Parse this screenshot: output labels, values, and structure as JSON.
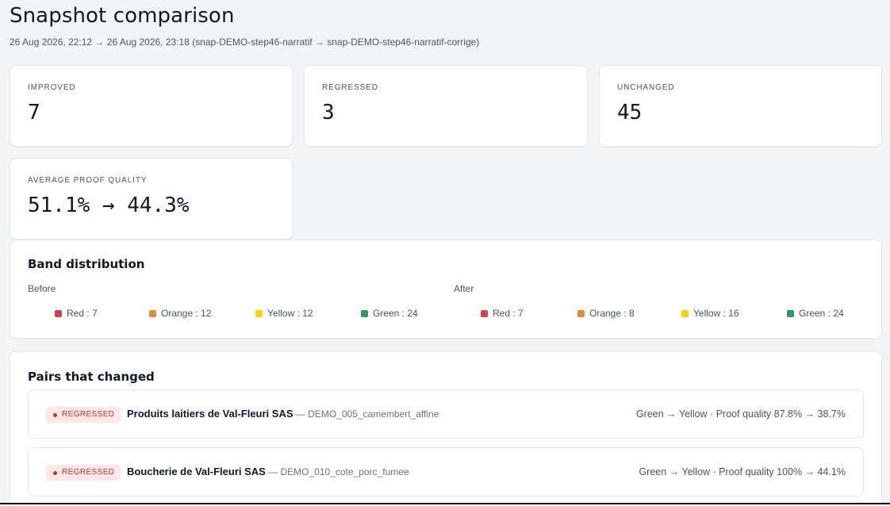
{
  "header": {
    "title": "Snapshot comparison",
    "subtitle": "26 Aug 2026, 22:12 → 26 Aug 2026, 23:18  (snap-DEMO-step46-narratif → snap-DEMO-step46-narratif-corrige)"
  },
  "stats": {
    "improved": {
      "label": "IMPROVED",
      "value": "7"
    },
    "regressed": {
      "label": "REGRESSED",
      "value": "3"
    },
    "unchanged": {
      "label": "UNCHANGED",
      "value": "45"
    },
    "avg_quality": {
      "label": "AVERAGE PROOF QUALITY",
      "value": "51.1% → 44.3%"
    }
  },
  "bands": {
    "title": "Band distribution",
    "before": {
      "label": "Before",
      "items": [
        {
          "text": "Red : 7",
          "color": "#d04545"
        },
        {
          "text": "Orange : 12",
          "color": "#e08a3c"
        },
        {
          "text": "Yellow : 12",
          "color": "#f2d600"
        },
        {
          "text": "Green : 24",
          "color": "#2e9a5e"
        }
      ]
    },
    "after": {
      "label": "After",
      "items": [
        {
          "text": "Red : 7",
          "color": "#d04545"
        },
        {
          "text": "Orange : 8",
          "color": "#e08a3c"
        },
        {
          "text": "Yellow : 16",
          "color": "#f2d600"
        },
        {
          "text": "Green : 24",
          "color": "#2e9a5e"
        }
      ]
    }
  },
  "pairs": {
    "title": "Pairs that changed",
    "items": [
      {
        "badge": "REGRESSED",
        "name": "Produits laitiers de Val-Fleuri SAS",
        "id": " — DEMO_005_camembert_affine",
        "change": "Green → Yellow  ·  Proof quality 87.8% → 38.7%"
      },
      {
        "badge": "REGRESSED",
        "name": "Boucherie de Val-Fleuri SAS",
        "id": " — DEMO_010_cote_porc_fumee",
        "change": "Green → Yellow  ·  Proof quality 100% → 44.1%"
      }
    ]
  },
  "colors": {
    "regressed": "#c53030",
    "regressed_bg": "#fde8e8"
  }
}
